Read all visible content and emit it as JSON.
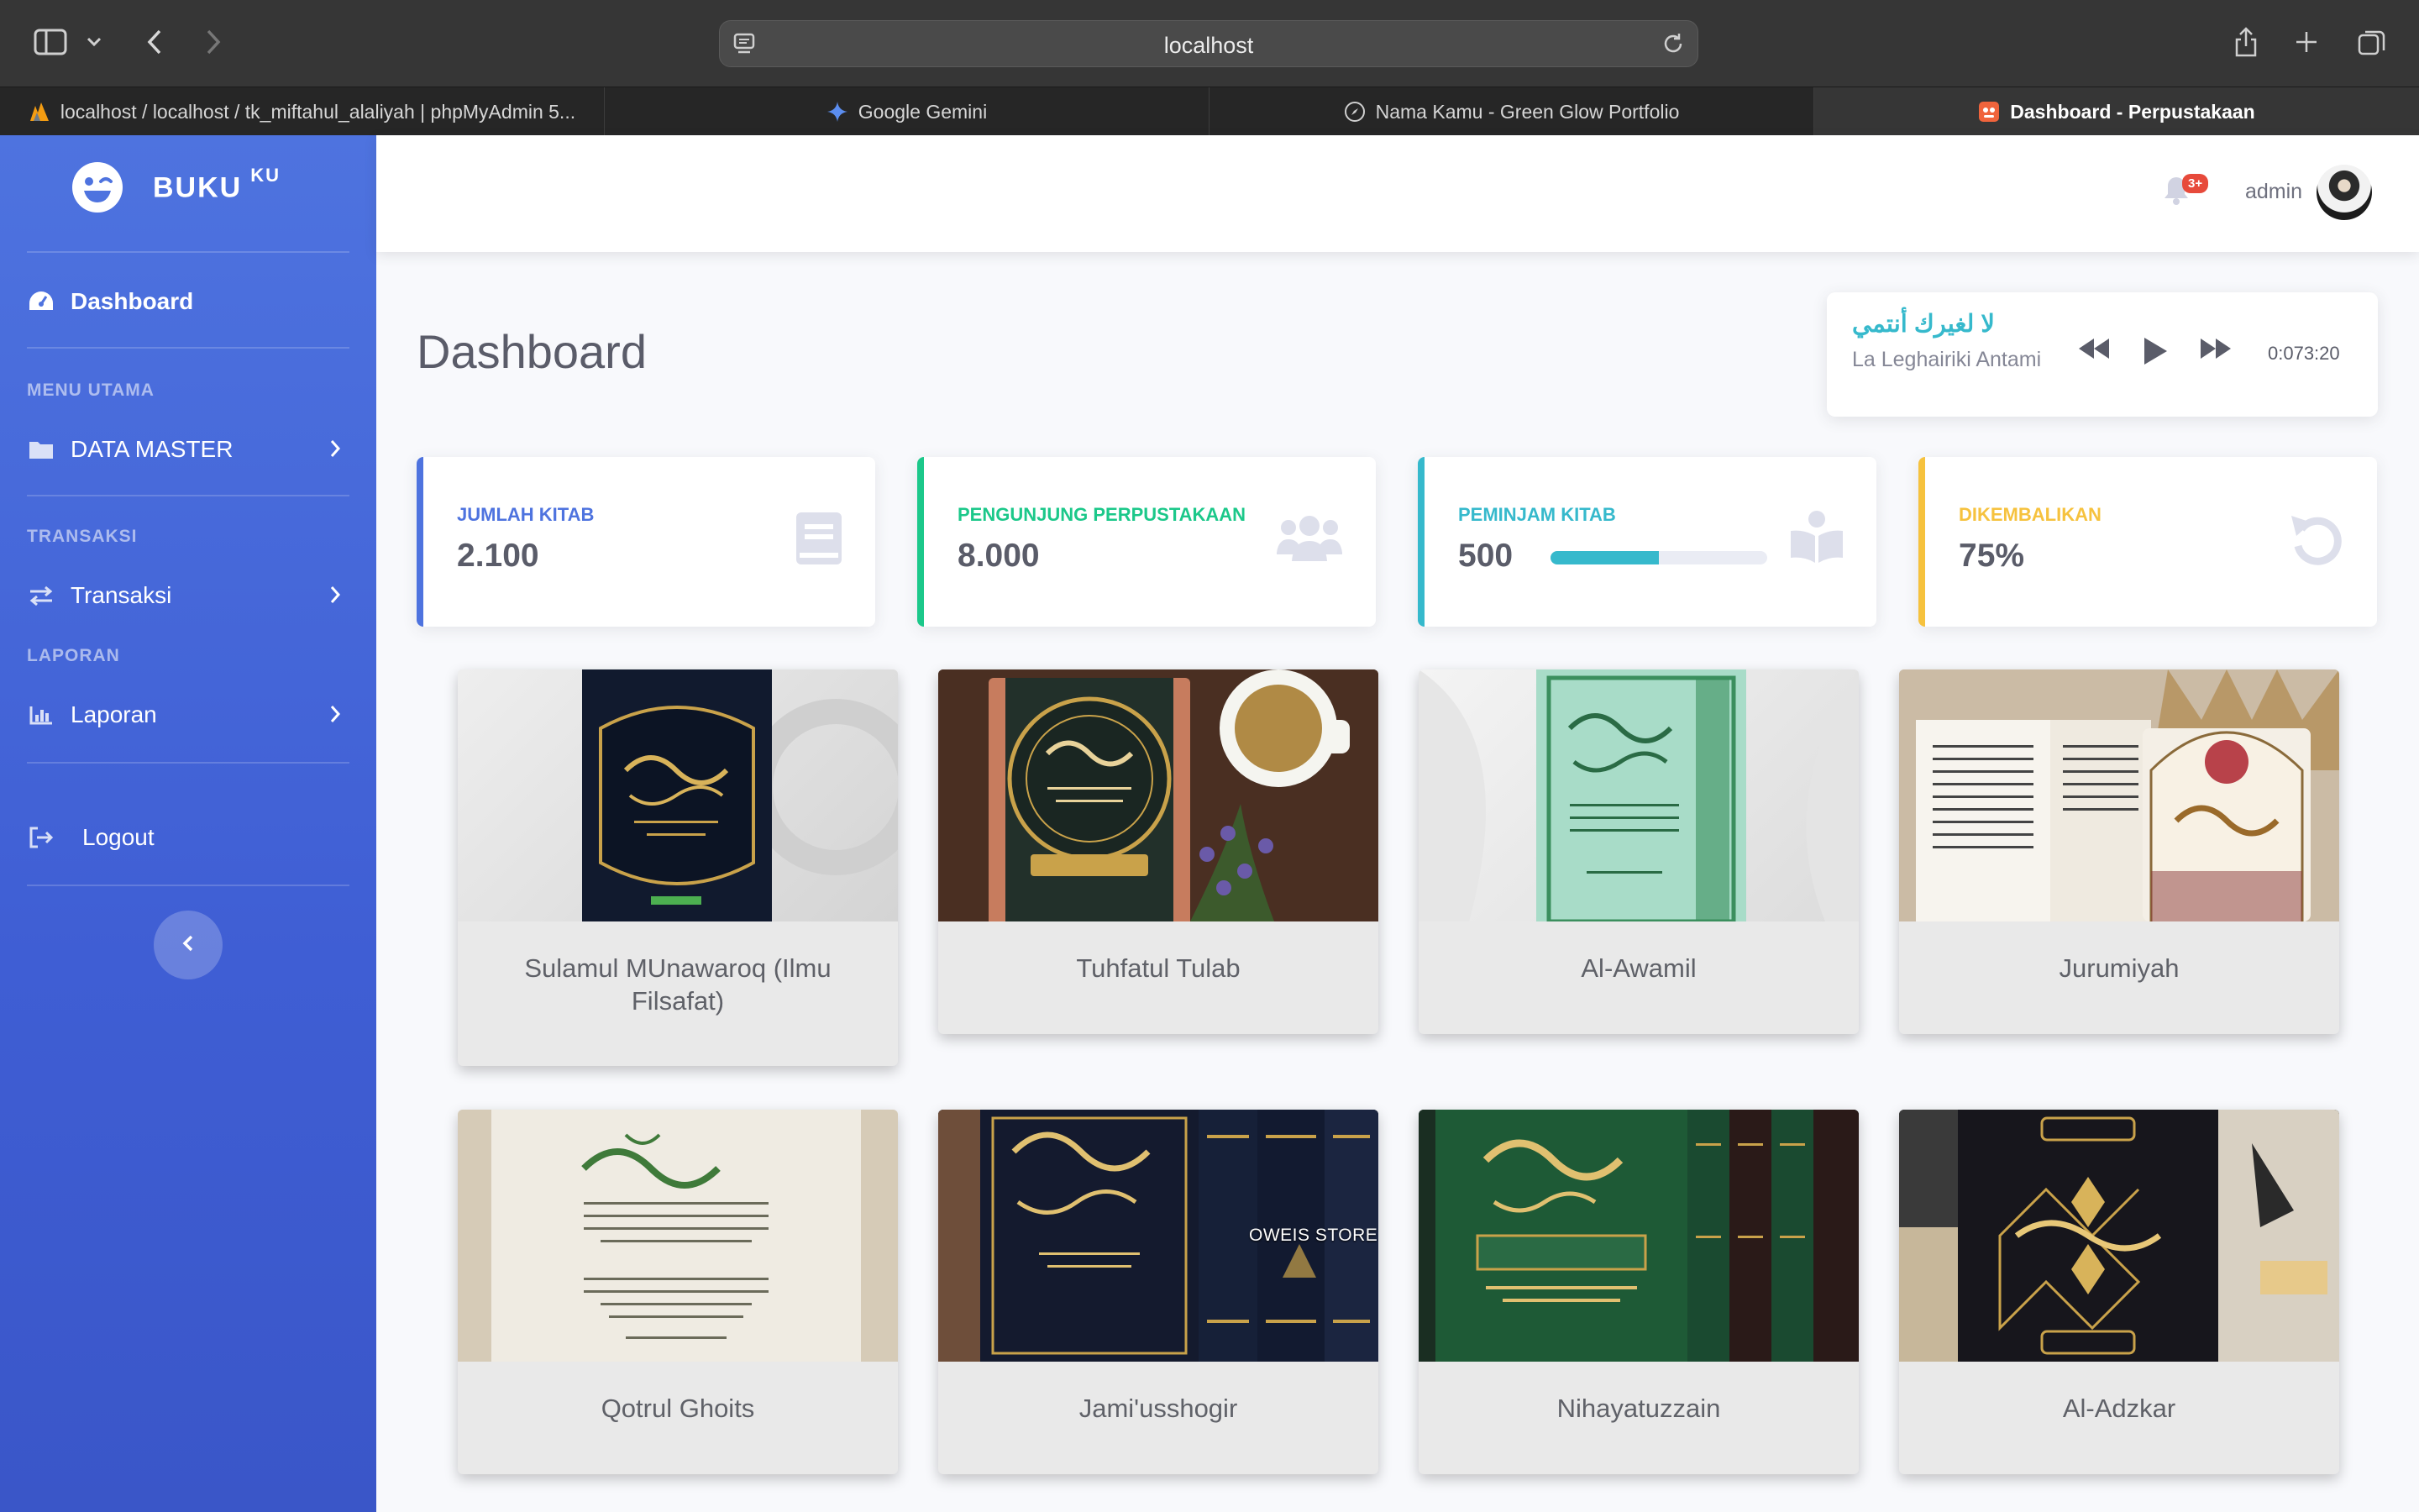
{
  "browser": {
    "url": "localhost",
    "tabs": [
      {
        "label": "localhost / localhost / tk_miftahul_alaliyah | phpMyAdmin 5...",
        "active": false
      },
      {
        "label": "Google Gemini",
        "active": false
      },
      {
        "label": "Nama Kamu - Green Glow Portfolio",
        "active": false
      },
      {
        "label": "Dashboard - Perpustakaan",
        "active": true
      }
    ]
  },
  "sidebar": {
    "brand": "BUKU",
    "brand_sup": "KU",
    "dashboard": "Dashboard",
    "heading_menu": "MENU UTAMA",
    "data_master": "DATA MASTER",
    "heading_transaksi": "TRANSAKSI",
    "transaksi": "Transaksi",
    "heading_laporan": "LAPORAN",
    "laporan": "Laporan",
    "logout": "Logout"
  },
  "topbar": {
    "notif_badge": "3+",
    "user": "admin"
  },
  "page": {
    "title": "Dashboard"
  },
  "player": {
    "title_arabic": "لا لغيرك أنتمي",
    "title_latin": "La Leghairiki Antami",
    "time": "0:073:20"
  },
  "stats": [
    {
      "label": "JUMLAH KITAB",
      "value": "2.100",
      "icon": "book-icon",
      "color": "#4e73df"
    },
    {
      "label": "PENGUNJUNG PERPUSTAKAAN",
      "value": "8.000",
      "icon": "users-icon",
      "color": "#1cc88a"
    },
    {
      "label": "PEMINJAM KITAB",
      "value": "500",
      "icon": "book-open-icon",
      "color": "#36b9cc",
      "progress": 0.5
    },
    {
      "label": "DIKEMBALIKAN",
      "value": "75%",
      "icon": "undo-icon",
      "color": "#f6c23e"
    }
  ],
  "books": [
    {
      "title": "Sulamul MUnawaroq (Ilmu Filsafat)"
    },
    {
      "title": "Tuhfatul Tulab"
    },
    {
      "title": "Al-Awamil"
    },
    {
      "title": "Jurumiyah"
    },
    {
      "title": "Qotrul Ghoits"
    },
    {
      "title": "Jami'usshogir",
      "watermark": "OWEIS STORE"
    },
    {
      "title": "Nihayatuzzain"
    },
    {
      "title": "Al-Adzkar"
    }
  ]
}
